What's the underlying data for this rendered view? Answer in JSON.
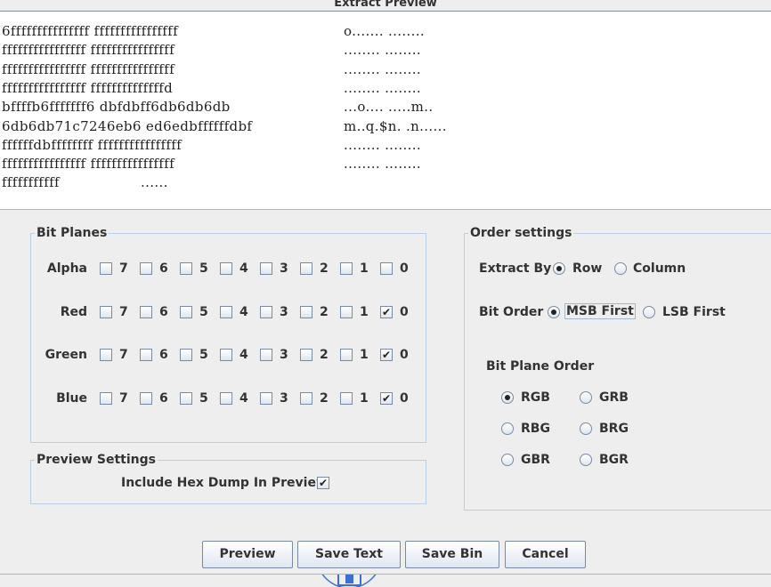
{
  "dialog": {
    "title": "Extract Preview"
  },
  "preview": {
    "lines": [
      {
        "hex": "6fffffffffffffff ffffffffffffffff",
        "ascii": "o....... ........"
      },
      {
        "hex": "ffffffffffffffff ffffffffffffffff",
        "ascii": "........ ........"
      },
      {
        "hex": "ffffffffffffffff ffffffffffffffff",
        "ascii": "........ ........"
      },
      {
        "hex": "ffffffffffffffff ffffffffffffffd",
        "ascii": "........ ........"
      },
      {
        "hex": "bffffb6fffffff6 dbfdbff6db6db6db",
        "ascii": "...o.... .....m.."
      },
      {
        "hex": "6db6db71c7246eb6 ed6edbffffffdbf",
        "ascii": "m..q.$n. .n......"
      },
      {
        "hex": "ffffffdbffffffff ffffffffffffffff",
        "ascii": "........ ........"
      },
      {
        "hex": "ffffffffffffffff ffffffffffffffff",
        "ascii": "........ ........"
      },
      {
        "hex": "fffffffffff",
        "ascii": "......"
      }
    ]
  },
  "bit_planes": {
    "legend": "Bit Planes",
    "bit_labels": [
      "7",
      "6",
      "5",
      "4",
      "3",
      "2",
      "1",
      "0"
    ],
    "rows": [
      {
        "label": "Alpha",
        "checked": [
          false,
          false,
          false,
          false,
          false,
          false,
          false,
          false
        ]
      },
      {
        "label": "Red",
        "checked": [
          false,
          false,
          false,
          false,
          false,
          false,
          false,
          true
        ]
      },
      {
        "label": "Green",
        "checked": [
          false,
          false,
          false,
          false,
          false,
          false,
          false,
          true
        ]
      },
      {
        "label": "Blue",
        "checked": [
          false,
          false,
          false,
          false,
          false,
          false,
          false,
          true
        ]
      }
    ]
  },
  "preview_settings": {
    "legend": "Preview Settings",
    "hex_dump_label": "Include Hex Dump In Preview",
    "hex_dump_checked": true
  },
  "order_settings": {
    "legend": "Order settings",
    "extract_by": {
      "label": "Extract By",
      "option_row": "Row",
      "option_column": "Column",
      "selected": "Row"
    },
    "bit_order": {
      "label": "Bit Order",
      "option_msb": "MSB First",
      "option_lsb": "LSB First",
      "selected": "MSB First"
    },
    "plane_order": {
      "label": "Bit Plane Order",
      "options": [
        "RGB",
        "GRB",
        "RBG",
        "BRG",
        "GBR",
        "BGR"
      ],
      "selected": "RGB"
    }
  },
  "buttons": {
    "preview": "Preview",
    "save_text": "Save Text",
    "save_bin": "Save Bin",
    "cancel": "Cancel"
  }
}
